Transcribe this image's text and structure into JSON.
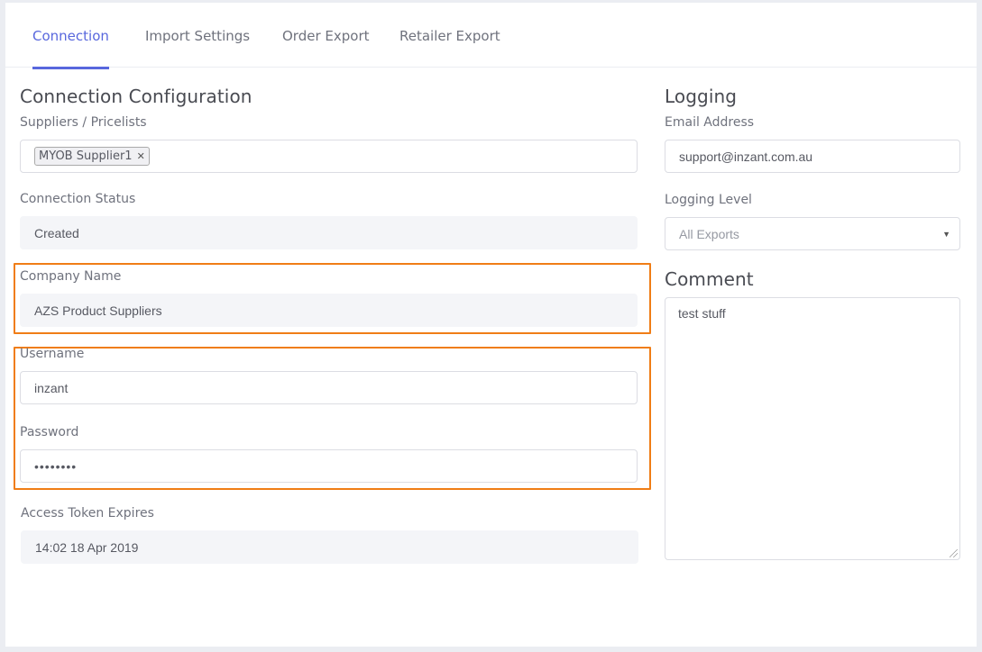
{
  "tabs": [
    {
      "label": "Connection",
      "active": true
    },
    {
      "label": "Import Settings",
      "active": false
    },
    {
      "label": "Order Export",
      "active": false
    },
    {
      "label": "Retailer Export",
      "active": false
    }
  ],
  "connection": {
    "title": "Connection Configuration",
    "suppliers_label": "Suppliers / Pricelists",
    "suppliers_tags": [
      "MYOB Supplier1"
    ],
    "status_label": "Connection Status",
    "status_value": "Created",
    "company_label": "Company Name",
    "company_value": "AZS Product Suppliers",
    "username_label": "Username",
    "username_value": "inzant",
    "password_label": "Password",
    "password_value": "••••••••",
    "token_label": "Access Token Expires",
    "token_value": "14:02 18 Apr 2019"
  },
  "logging": {
    "title": "Logging",
    "email_label": "Email Address",
    "email_value": "support@inzant.com.au",
    "level_label": "Logging Level",
    "level_value": "All Exports"
  },
  "comment": {
    "title": "Comment",
    "value": "test stuff"
  },
  "colors": {
    "accent": "#5867dd",
    "highlight": "#f07d16"
  }
}
